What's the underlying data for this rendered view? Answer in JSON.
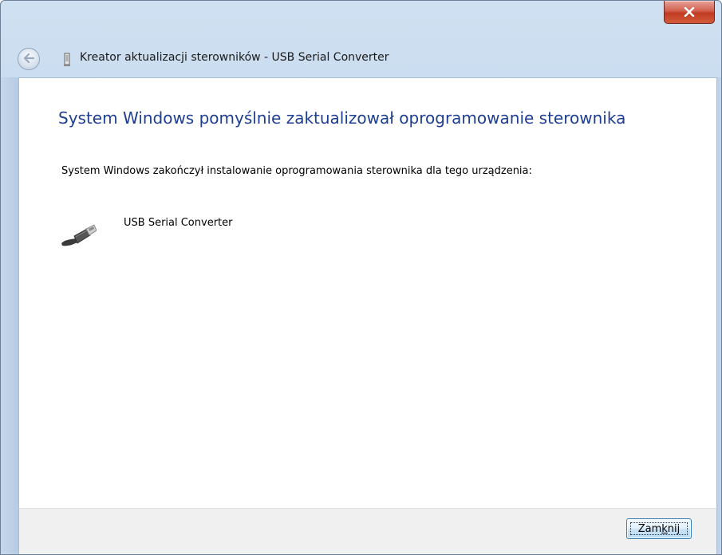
{
  "window": {
    "title": "Kreator aktualizacji sterowników - USB Serial Converter"
  },
  "content": {
    "heading": "System Windows pomyślnie zaktualizował oprogramowanie sterownika",
    "message": "System Windows zakończył instalowanie oprogramowania sterownika dla tego urządzenia:",
    "device_name": "USB Serial Converter",
    "device_icon": "usb-plug-icon"
  },
  "footer": {
    "close_label_prefix": "Zam",
    "close_label_accel": "k",
    "close_label_suffix": "nij"
  },
  "icons": {
    "close": "close-icon",
    "back": "back-arrow-icon",
    "wizard": "wizard-icon"
  },
  "colors": {
    "heading": "#1e3e93",
    "close_button_red": "#c03a22",
    "frame": "#bcd3ea"
  }
}
